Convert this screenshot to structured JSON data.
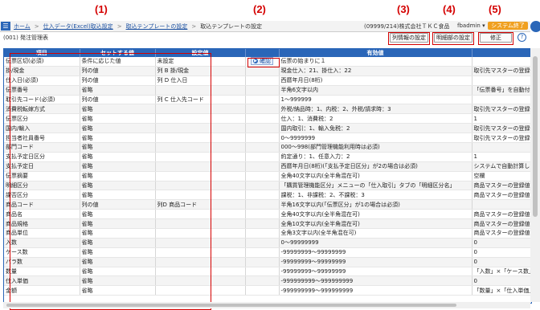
{
  "callouts": [
    "(1)",
    "(2)",
    "(3)",
    "(4)",
    "(5)"
  ],
  "topbar": {
    "breadcrumbs": [
      "ホーム",
      "仕入データ(Excel)取込設定",
      "取込テンプレートの設定",
      "取込テンプレートの設定"
    ],
    "company": "(09999/214)株式会社ＴＫＣ食品",
    "user": "fbadmin ▾",
    "exit_label": "システム終了"
  },
  "subbar": {
    "screen_title": "(001) 発注管理表",
    "col_info_button": "列情報の設定",
    "detail_button": "明細部の設定",
    "edit_button": "修正",
    "help_label": "?"
  },
  "table": {
    "headers": [
      "項目",
      "セットする値",
      "設定値",
      "",
      "有効値",
      ""
    ],
    "confirm_label": "確認",
    "rows": [
      {
        "item": "伝票区切(必須)",
        "set": "条件に応じた値",
        "val": "未設定",
        "valid": "伝票の始まりに１",
        "note": ""
      },
      {
        "item": "掛/現金",
        "set": "列の値",
        "val": "列 B 掛/現金",
        "valid": "現金仕入：21、掛仕入：22",
        "note": "取引先マスターの登録値"
      },
      {
        "item": "仕入日(必須)",
        "set": "列の値",
        "val": "列 D 仕入日",
        "valid": "西暦年月日(8桁)",
        "note": ""
      },
      {
        "item": "伝票番号",
        "set": "省略",
        "val": "",
        "valid": "半角6文字以内",
        "note": "「伝票番号」を自動付番"
      },
      {
        "item": "取引先コード(必須)",
        "set": "列の値",
        "val": "列 C 仕入先コード",
        "valid": "1〜999999",
        "note": ""
      },
      {
        "item": "消費税転嫁方式",
        "set": "省略",
        "val": "",
        "valid": "外税/納品時：1、内税：2、外税/請求時：3",
        "note": "取引先マスターの登録値"
      },
      {
        "item": "伝票区分",
        "set": "省略",
        "val": "",
        "valid": "仕入：1、消費税：2",
        "note": "1"
      },
      {
        "item": "国内/輸入",
        "set": "省略",
        "val": "",
        "valid": "国内取引：1、輸入免税：2",
        "note": "取引先マスターの登録値"
      },
      {
        "item": "担当者社員番号",
        "set": "省略",
        "val": "",
        "valid": "0〜9999999",
        "note": "取引先マスターの登録値"
      },
      {
        "item": "部門コード",
        "set": "省略",
        "val": "",
        "valid": "000〜998(部門管理機能利用時は必須)",
        "note": ""
      },
      {
        "item": "支払予定日区分",
        "set": "省略",
        "val": "",
        "valid": "約定通り：1、任意入力：2",
        "note": "1"
      },
      {
        "item": "支払予定日",
        "set": "省略",
        "val": "",
        "valid": "西暦年月日(8桁)(「支払予定日区分」が2の場合は必須)",
        "note": "システムで自動計算した"
      },
      {
        "item": "伝票摘要",
        "set": "省略",
        "val": "",
        "valid": "全角40文字以内(全半角混在可)",
        "note": "空欄"
      },
      {
        "item": "明細区分",
        "set": "省略",
        "val": "",
        "valid": "「購買管理機能区分」メニューの「仕入取引」タブの「明細区分名」",
        "note": "商品マスターの登録値"
      },
      {
        "item": "課否区分",
        "set": "省略",
        "val": "",
        "valid": "課税：1、非課税：2、不課税：3",
        "note": "商品マスターの登録値"
      },
      {
        "item": "商品コード",
        "set": "列の値",
        "val": "列D 商品コード",
        "valid": "半角16文字以内(「伝票区分」が1の場合は必須)",
        "note": ""
      },
      {
        "item": "商品名",
        "set": "省略",
        "val": "",
        "valid": "全角40文字以内(全半角混在可)",
        "note": "商品マスターの登録値"
      },
      {
        "item": "商品規格",
        "set": "省略",
        "val": "",
        "valid": "全角10文字以内(全半角混在可)",
        "note": "商品マスターの登録値"
      },
      {
        "item": "商品単位",
        "set": "省略",
        "val": "",
        "valid": "全角3文字以内(全半角混在可)",
        "note": "商品マスターの登録値"
      },
      {
        "item": "入数",
        "set": "省略",
        "val": "",
        "valid": "0〜99999999",
        "note": "0"
      },
      {
        "item": "ケース数",
        "set": "省略",
        "val": "",
        "valid": "-99999999〜99999999",
        "note": "0"
      },
      {
        "item": "バラ数",
        "set": "省略",
        "val": "",
        "valid": "-99999999〜99999999",
        "note": "0"
      },
      {
        "item": "数量",
        "set": "省略",
        "val": "",
        "valid": "-99999999〜99999999",
        "note": "「入数」×「ケース数」"
      },
      {
        "item": "仕入単価",
        "set": "省略",
        "val": "",
        "valid": "-999999999〜999999999",
        "note": "0"
      },
      {
        "item": "金額",
        "set": "省略",
        "val": "",
        "valid": "-999999999〜999999999",
        "note": "「数量」×「仕入単価」"
      }
    ]
  },
  "colors": {
    "accent": "#2a66b8",
    "callout": "#d40000",
    "exit": "#f0a020"
  }
}
